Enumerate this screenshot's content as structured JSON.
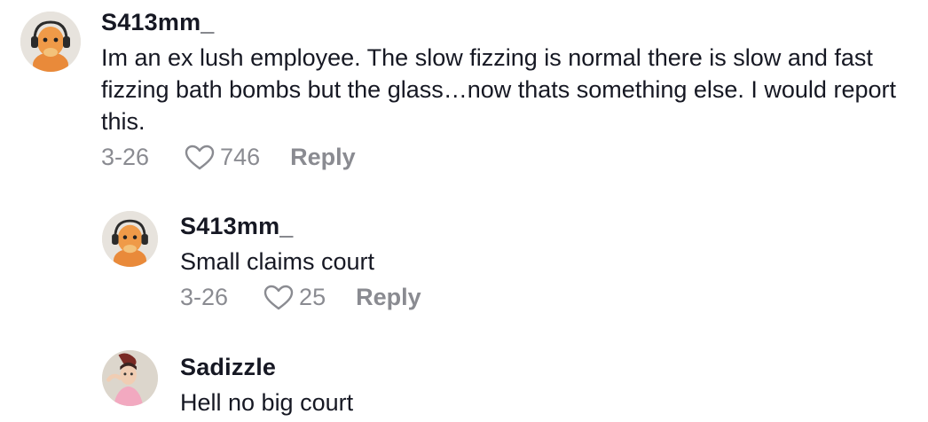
{
  "comments": [
    {
      "username": "S413mm_",
      "text": "Im an ex lush employee. The slow fizzing is normal there is slow and fast fizzing bath bombs but the glass…now thats something else. I would report this.",
      "date": "3-26",
      "likes": "746",
      "reply_label": "Reply",
      "avatar_icon": "charmander-headphones-avatar"
    },
    {
      "username": "S413mm_",
      "text": "Small claims court",
      "date": "3-26",
      "likes": "25",
      "reply_label": "Reply",
      "avatar_icon": "charmander-headphones-avatar"
    },
    {
      "username": "Sadizzle",
      "text": "Hell no big court",
      "avatar_icon": "cartoon-woman-avatar"
    }
  ],
  "colors": {
    "primary_text": "#161823",
    "secondary_text": "#8a8b91"
  }
}
